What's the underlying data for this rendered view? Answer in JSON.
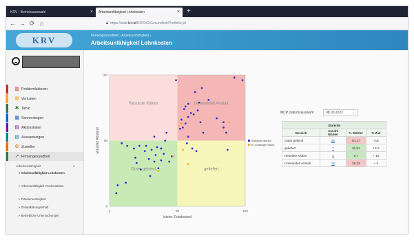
{
  "browser": {
    "tabs": [
      {
        "label": "KRV - Betriebsauswahl",
        "close": "×"
      },
      {
        "label": "Arbeitsunfähigkeit Lohnkosten",
        "close": "×"
      }
    ],
    "new_tab": "+",
    "nav": {
      "back": "←",
      "forward": "→",
      "reload": "⟳",
      "home": "⌂"
    },
    "url": {
      "prefix": "https://web.",
      "host": "krv.at",
      "path": "/KRVNG/Gesundheit/Portfolio.jsf"
    }
  },
  "app": {
    "logo": "KRV",
    "breadcrumb": "Firmengesundheit › Arbeitsunfähigkeit ›",
    "title": "Arbeitsunfähigkeit Lohnkosten"
  },
  "sidebar": {
    "items": [
      {
        "label": "Problemfaktoren",
        "icon": "bar-chart-icon",
        "glyph": "▥",
        "color": "#c62828"
      },
      {
        "label": "Verlusten",
        "icon": "table-icon",
        "glyph": "▦",
        "color": "#f9a825"
      },
      {
        "label": "Tarvo",
        "icon": "settings-icon",
        "glyph": "✱",
        "color": "#2e7d32"
      },
      {
        "label": "Sonnenbogen",
        "icon": "grid-icon",
        "glyph": "▦",
        "color": "#1565c0"
      },
      {
        "label": "Aktionslisten",
        "icon": "calendar-icon",
        "glyph": "▤",
        "color": "#6a1b9a"
      },
      {
        "label": "Auswertungen",
        "icon": "report-icon",
        "glyph": "▤",
        "color": "#00838f"
      },
      {
        "label": "Zusteller",
        "icon": "gear-icon",
        "glyph": "⚙",
        "color": "#ef6c00"
      },
      {
        "label": "Firmengesundheit",
        "icon": "line-chart-icon",
        "glyph": "↗",
        "color": "#2e7d32"
      }
    ],
    "group_label": "Arbeitsunfähigkeit",
    "group_chevron": "∧",
    "sub_items": [
      "» Arbeitsunfähigkeit Lohnkosten",
      "» Arbeitsunfähigkeit Trockenaktion",
      "» Tetanieruxebrigkeit",
      "» Zeitaufklärungsinhalt",
      "» Betriebliche Untersuchungen"
    ]
  },
  "chart": {
    "quadrant_labels": [
      "Resolute Klöten",
      "Umwandelt Anstalt",
      "Guter gelsind",
      "geliefert"
    ],
    "quadrant_colors": [
      "#fbdedb",
      "#f4b7b6",
      "#c8eab4",
      "#f7f6ba"
    ],
    "series_colors": [
      "#3a33c9",
      "#f0ad22"
    ]
  },
  "chart_data": {
    "type": "scatter",
    "title": "",
    "xlabel": "letzter Zeitabstand",
    "ylabel": "aktueller Abstand",
    "xlim": [
      0,
      100
    ],
    "ylim": [
      0,
      100
    ],
    "x_ticks": [
      "0",
      "50",
      "100"
    ],
    "y_ticks": [
      "0",
      "50",
      "100"
    ],
    "legend_position": "right",
    "series": [
      {
        "name": "Kategorie aktuell",
        "points": [
          [
            5,
            10
          ],
          [
            9,
            48
          ],
          [
            13,
            46
          ],
          [
            18,
            44
          ],
          [
            20,
            33
          ],
          [
            22,
            46
          ],
          [
            26,
            42
          ],
          [
            29,
            36
          ],
          [
            31,
            43
          ],
          [
            33,
            53
          ],
          [
            34,
            39
          ],
          [
            36,
            29
          ],
          [
            38,
            44
          ],
          [
            40,
            40
          ],
          [
            42,
            56
          ],
          [
            44,
            34
          ],
          [
            46,
            38
          ],
          [
            30,
            23
          ],
          [
            33,
            34
          ],
          [
            27,
            46
          ],
          [
            12,
            18
          ],
          [
            6,
            16
          ],
          [
            23,
            28
          ],
          [
            38,
            35
          ],
          [
            41,
            50
          ],
          [
            19,
            37
          ],
          [
            35,
            45
          ],
          [
            49,
            96
          ],
          [
            52,
            59
          ],
          [
            53,
            66
          ],
          [
            54,
            60
          ],
          [
            55,
            74
          ],
          [
            56,
            63
          ],
          [
            56,
            76
          ],
          [
            58,
            68
          ],
          [
            57,
            48
          ],
          [
            58,
            53
          ],
          [
            60,
            71
          ],
          [
            61,
            44
          ],
          [
            62,
            70
          ],
          [
            63,
            87
          ],
          [
            64,
            42
          ],
          [
            65,
            73
          ],
          [
            66,
            79
          ],
          [
            67,
            64
          ],
          [
            68,
            90
          ],
          [
            69,
            56
          ],
          [
            73,
            81
          ],
          [
            79,
            67
          ],
          [
            84,
            64
          ],
          [
            84,
            60
          ],
          [
            86,
            56
          ],
          [
            87,
            43
          ],
          [
            58,
            78
          ],
          [
            92,
            98
          ],
          [
            98,
            96
          ]
        ]
      },
      {
        "name": "B. vorläufiger Stand",
        "points": [
          [
            36,
            27
          ],
          [
            53,
            63
          ],
          [
            47,
            38
          ],
          [
            58,
            32
          ],
          [
            88,
            64
          ],
          [
            54,
            43
          ]
        ]
      }
    ]
  },
  "statistics": {
    "date_label": "MCP Datumsauswahl:",
    "date_value": "08.03.2022",
    "date_chevron": "⌄",
    "title": "Statistik",
    "headers": [
      "Bereich",
      "Anzahl Wähler",
      "% Wähler",
      "% Ziel"
    ],
    "rows": [
      {
        "name": "Guter gelsind",
        "count": "26",
        "pct": "54,17",
        "delta": "+15",
        "pct_color": "#f2c7c5"
      },
      {
        "name": "geliefert",
        "count": "7",
        "pct": "20,81",
        "delta": "+0,7",
        "pct_color": "#c6e7c0"
      },
      {
        "name": "Resolute Klöten",
        "count": "3",
        "pct": "8,7",
        "delta": "+ 15",
        "pct_color": "#c6e7c0"
      },
      {
        "name": "Umwandelt Anstalt",
        "count": "19",
        "pct": "39,33",
        "delta": "+ 0",
        "pct_color": "#f2c7c5"
      }
    ]
  }
}
